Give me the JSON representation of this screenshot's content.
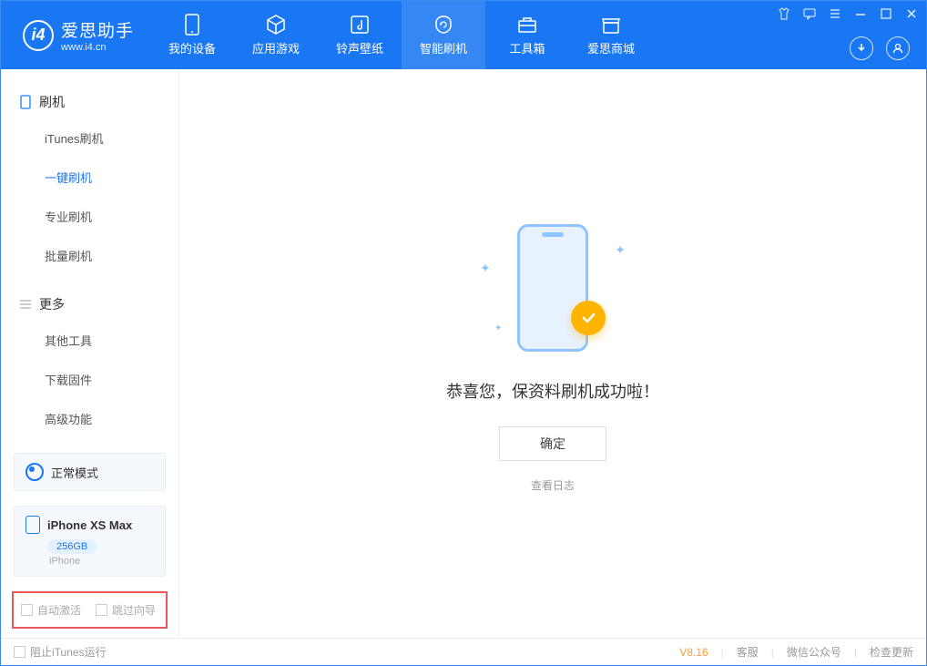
{
  "app": {
    "title": "爱思助手",
    "subtitle": "www.i4.cn"
  },
  "nav": [
    {
      "label": "我的设备"
    },
    {
      "label": "应用游戏"
    },
    {
      "label": "铃声壁纸"
    },
    {
      "label": "智能刷机"
    },
    {
      "label": "工具箱"
    },
    {
      "label": "爱思商城"
    }
  ],
  "sidebar": {
    "section1_title": "刷机",
    "items1": [
      {
        "label": "iTunes刷机"
      },
      {
        "label": "一键刷机"
      },
      {
        "label": "专业刷机"
      },
      {
        "label": "批量刷机"
      }
    ],
    "section2_title": "更多",
    "items2": [
      {
        "label": "其他工具"
      },
      {
        "label": "下载固件"
      },
      {
        "label": "高级功能"
      }
    ]
  },
  "device": {
    "mode_label": "正常模式",
    "name": "iPhone XS Max",
    "capacity": "256GB",
    "type": "iPhone"
  },
  "bottom_checks": {
    "auto_activate": "自动激活",
    "skip_guide": "跳过向导"
  },
  "main": {
    "success_text": "恭喜您，保资料刷机成功啦！",
    "ok_label": "确定",
    "view_log_label": "查看日志"
  },
  "statusbar": {
    "block_itunes": "阻止iTunes运行",
    "version": "V8.16",
    "links": [
      "客服",
      "微信公众号",
      "检查更新"
    ]
  }
}
